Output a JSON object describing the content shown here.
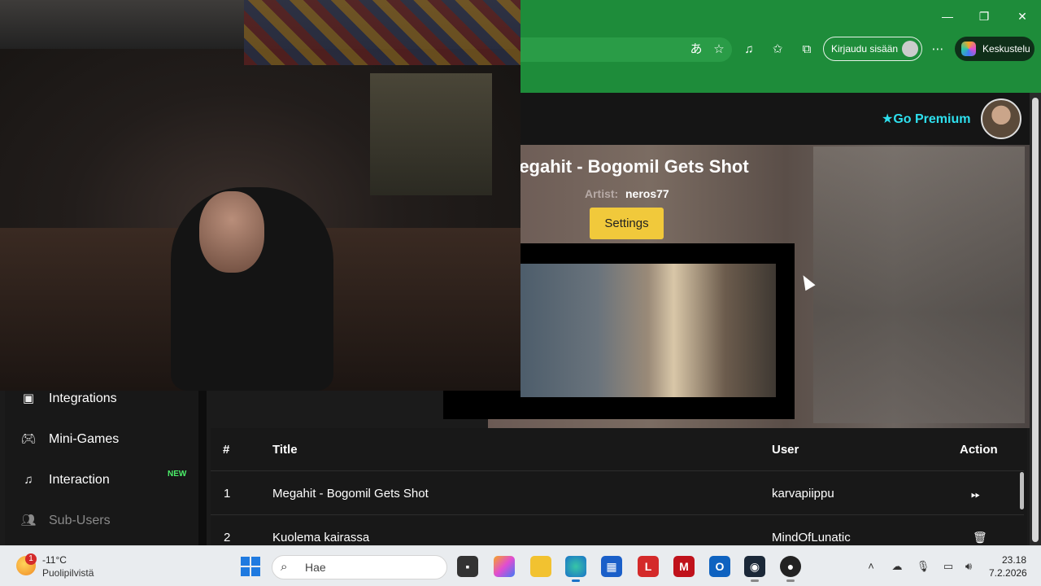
{
  "browser": {
    "signin_label": "Kirjaudu sisään",
    "copilot_label": "Keskustelu",
    "window_controls": [
      "minimize-icon",
      "restore-icon",
      "close-icon"
    ]
  },
  "header": {
    "premium_label": "Go Premium"
  },
  "now_playing": {
    "title": "Megahit - Bogomil Gets Shot",
    "artist_label": "Artist:",
    "artist": "neros77",
    "settings_label": "Settings"
  },
  "sidebar": {
    "items": [
      {
        "label": "Integrations",
        "icon": "integrations-icon"
      },
      {
        "label": "Mini-Games",
        "icon": "gamepad-icon"
      },
      {
        "label": "Interaction",
        "icon": "music-note-icon",
        "badge": "NEW"
      },
      {
        "label": "Sub-Users",
        "icon": "users-icon"
      }
    ]
  },
  "queue": {
    "columns": [
      "#",
      "Title",
      "User",
      "Action"
    ],
    "rows": [
      {
        "num": "1",
        "title": "Megahit - Bogomil Gets Shot",
        "user": "karvapiippu",
        "action": "skip-icon"
      },
      {
        "num": "2",
        "title": "Kuolema kairassa",
        "user": "MindOfLunatic",
        "action": "trash-icon"
      }
    ]
  },
  "taskbar": {
    "weather_badge": "1",
    "temperature": "-11°C",
    "weather_desc": "Puolipilvistä",
    "search_placeholder": "Hae",
    "time": "23.18",
    "date": "7.2.2026",
    "accent": "#1e8c3a"
  }
}
